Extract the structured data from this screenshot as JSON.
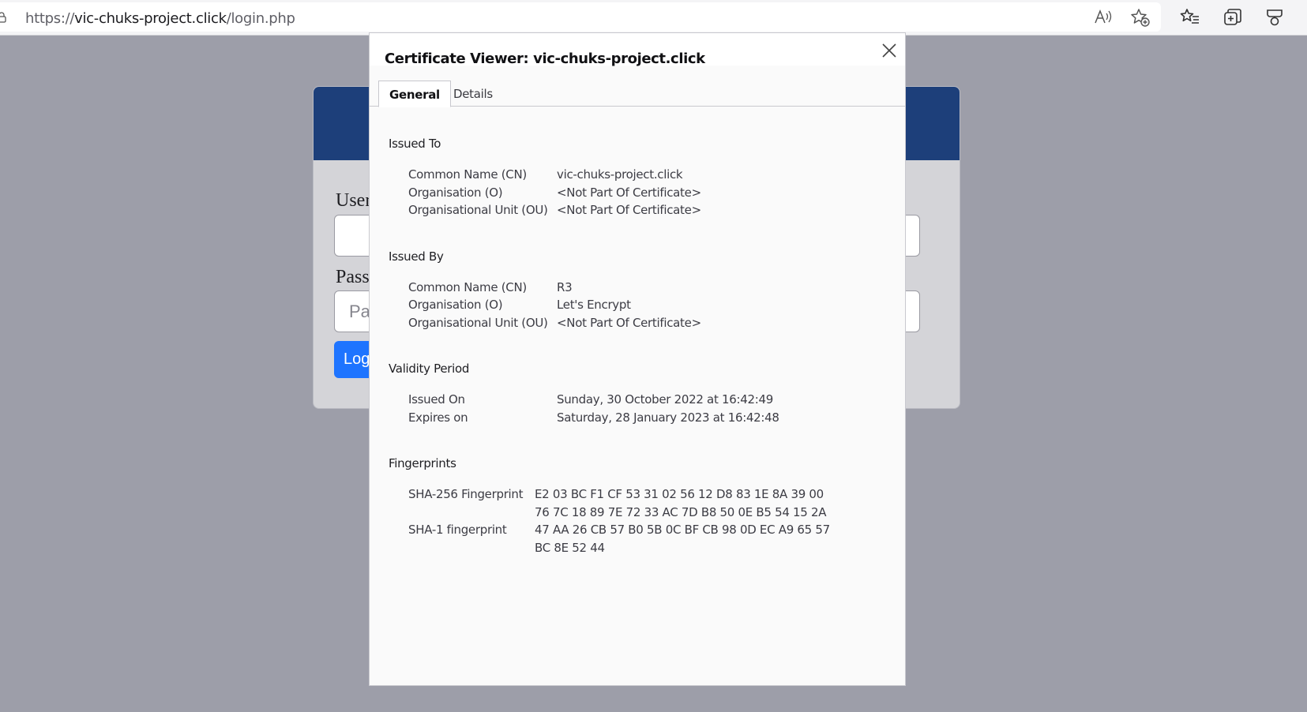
{
  "browser": {
    "url_scheme": "https://",
    "url_host": "vic-chuks-project.click",
    "url_path": "/login.php",
    "icons": [
      "lock-icon",
      "read-aloud-icon",
      "add-favorite-icon",
      "favorites-icon",
      "collections-icon",
      "extensions-icon"
    ]
  },
  "page": {
    "username_label": "User",
    "password_label": "Pass",
    "password_placeholder": "Pa",
    "login_button": "Log",
    "header_color": "#1d3f7a",
    "button_color": "#1e74ff"
  },
  "dialog": {
    "title": "Certificate Viewer: vic-chuks-project.click",
    "tabs": {
      "general": "General",
      "details": "Details"
    },
    "issued_to": {
      "heading": "Issued To",
      "rows": [
        {
          "label": "Common Name (CN)",
          "value": "vic-chuks-project.click"
        },
        {
          "label": "Organisation (O)",
          "value": "<Not Part Of Certificate>"
        },
        {
          "label": "Organisational Unit (OU)",
          "value": "<Not Part Of Certificate>"
        }
      ]
    },
    "issued_by": {
      "heading": "Issued By",
      "rows": [
        {
          "label": "Common Name (CN)",
          "value": "R3"
        },
        {
          "label": "Organisation (O)",
          "value": "Let's Encrypt"
        },
        {
          "label": "Organisational Unit (OU)",
          "value": "<Not Part Of Certificate>"
        }
      ]
    },
    "validity": {
      "heading": "Validity Period",
      "rows": [
        {
          "label": "Issued On",
          "value": "Sunday, 30 October 2022 at 16:42:49"
        },
        {
          "label": "Expires on",
          "value": "Saturday, 28 January 2023 at 16:42:48"
        }
      ]
    },
    "fingerprints": {
      "heading": "Fingerprints",
      "sha256_label": "SHA-256 Fingerprint",
      "sha256_line1": "E2 03 BC F1 CF 53 31 02 56 12 D8 83 1E 8A 39 00",
      "sha256_line2": "76 7C 18 89 7E 72 33 AC 7D B8 50 0E B5 54 15 2A",
      "sha1_label": "SHA-1 fingerprint",
      "sha1_line1": "47 AA 26 CB 57 B0 5B 0C BF CB 98 0D EC A9 65 57",
      "sha1_line2": "BC 8E 52 44"
    }
  }
}
